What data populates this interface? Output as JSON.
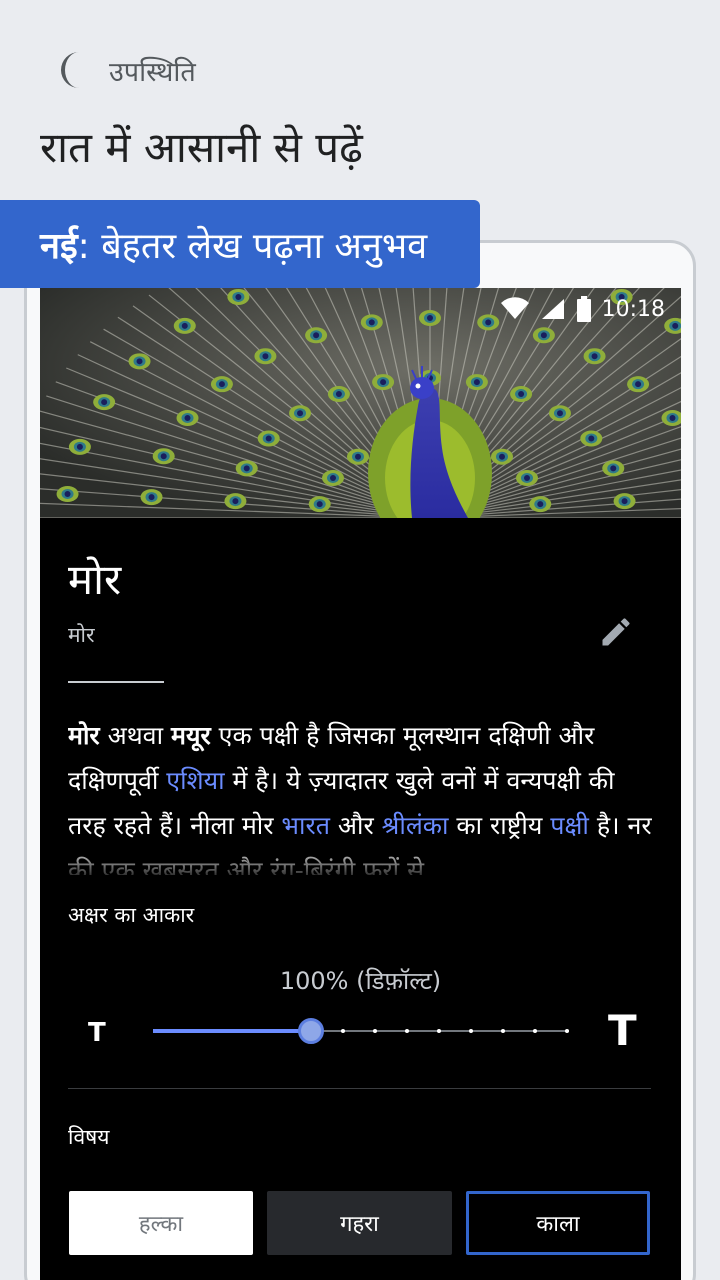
{
  "header": {
    "section_icon": "moon-icon",
    "section_label": "उपस्थिति",
    "headline": "रात में आसानी से पढ़ें"
  },
  "banner": {
    "bold": "नई",
    "text": ": बेहतर लेख पढ़ना अनुभव"
  },
  "status_bar": {
    "time": "10:18",
    "icons": [
      "wifi-icon",
      "signal-icon",
      "battery-icon"
    ]
  },
  "article": {
    "image": "peacock-image",
    "title": "मोर",
    "description": "मोर",
    "edit_icon": "pencil-icon",
    "body": {
      "w1": "मोर",
      "t1": " अथवा ",
      "w2": "मयूर",
      "t2": " एक पक्षी है जिसका मूलस्थान दक्षिणी और दक्षिणपूर्वी ",
      "l1": "एशिया",
      "t3": " में है। ये ज़्यादातर खुले वनों में वन्यपक्षी की तरह रहते हैं। नीला मोर ",
      "l2": "भारत",
      "t4": " और ",
      "l3": "श्रीलंका",
      "t5": " का राष्ट्रीय ",
      "l4": "पक्षी",
      "t6": " है। नर की एक खूबसूरत और रंग-बिरंगी फरों से"
    }
  },
  "font_settings": {
    "label": "अक्षर का आकार",
    "value_label": "100% (डिफ़ॉल्ट)",
    "small_t": "T",
    "large_t": "T",
    "slider_fraction": 0.38,
    "tick_count": 8
  },
  "theme": {
    "label": "विषय",
    "options": [
      "हल्का",
      "गहरा",
      "काला"
    ],
    "selected": "काला"
  },
  "colors": {
    "accent": "#3366cc",
    "link": "#6b8cff",
    "background": "#eaecf0"
  }
}
